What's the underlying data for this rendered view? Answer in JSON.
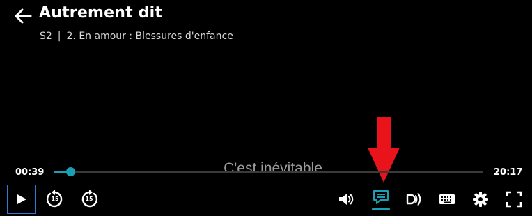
{
  "header": {
    "title": "Autrement dit",
    "season": "S2",
    "separator": "|",
    "episode": "2. En amour : Blessures d'enfance"
  },
  "caption": "C'est inévitable",
  "player": {
    "current_time": "00:39",
    "total_time": "20:17",
    "progress_fraction": 0.039,
    "skip_back_seconds": "15",
    "skip_forward_seconds": "15",
    "active_control": "subtitles",
    "accent_color": "#1aa0b5",
    "focus_color": "#2f7bd6",
    "annotation_color": "#e8131b"
  },
  "icons": {
    "back": "back-arrow-icon",
    "play": "play-icon",
    "rewind": "rewind-15-icon",
    "forward": "forward-15-icon",
    "volume": "volume-icon",
    "subtitles": "subtitles-icon",
    "audio_description": "audio-description-icon",
    "keyboard": "keyboard-icon",
    "settings": "gear-icon",
    "fullscreen": "fullscreen-icon",
    "annotation": "red-down-arrow"
  }
}
